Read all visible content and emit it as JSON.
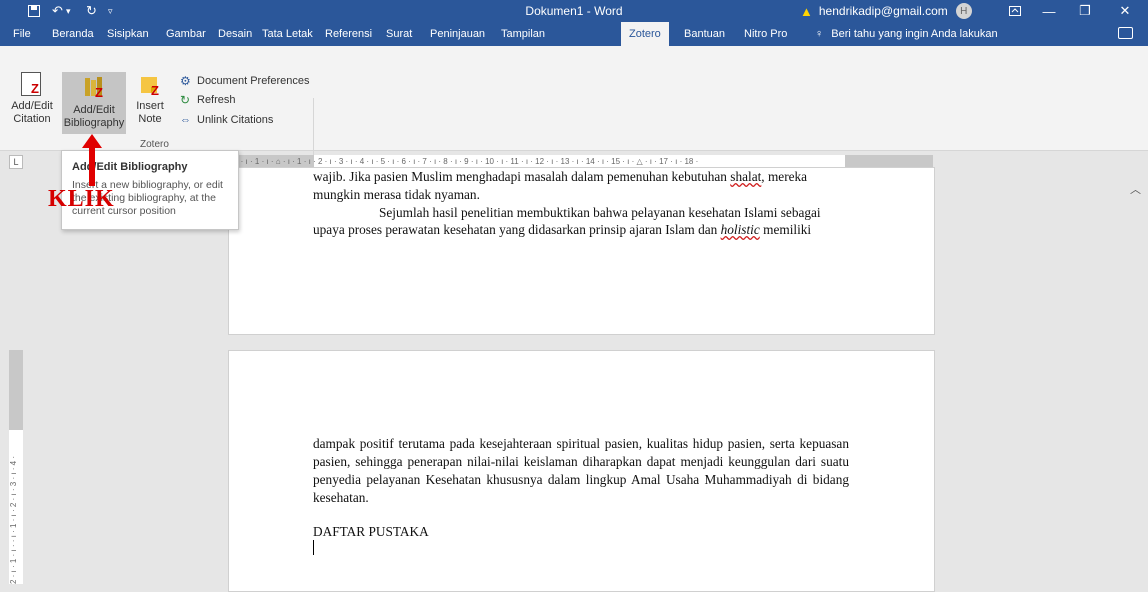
{
  "titlebar": {
    "title": "Dokumen1  -  Word",
    "user_email": "hendrikadip@gmail.com",
    "avatar_initial": "H",
    "accent_color": "#2b579a"
  },
  "menu": {
    "tabs": [
      "File",
      "Beranda",
      "Sisipkan",
      "Gambar",
      "Desain",
      "Tata Letak",
      "Referensi",
      "Surat",
      "Peninjauan",
      "Tampilan",
      "Zotero",
      "Bantuan",
      "Nitro Pro"
    ],
    "active": "Zotero",
    "tell_me": "Beri tahu yang ingin Anda lakukan"
  },
  "ribbon": {
    "add_edit_citation": "Add/Edit Citation",
    "add_edit_citation_l1": "Add/Edit",
    "add_edit_citation_l2": "Citation",
    "add_edit_bibliography_l1": "Add/Edit",
    "add_edit_bibliography_l2": "Bibliography",
    "insert_note_l1": "Insert",
    "insert_note_l2": "Note",
    "document_preferences": "Document Preferences",
    "refresh": "Refresh",
    "unlink_citations": "Unlink Citations",
    "group_label": "Zotero"
  },
  "tooltip": {
    "title": "Add/Edit Bibliography",
    "description": "Insert a new bibliography, or edit the existing bibliography, at the current cursor position"
  },
  "annotation": {
    "label": "KLIK",
    "color": "#d60000"
  },
  "ruler": {
    "horizontal": "2 · ı · 1 · ı · ⌂ · ı · 1 · ı · 2 · ı · 3 · ı · 4 · ı · 5 · ı · 6 · ı · 7 · ı · 8 · ı · 9 · ı · 10 · ı · 11 · ı · 12 · ı · 13 · ı · 14 · ı · 15 · ı · △ · ı · 17 · ı · 18 ·",
    "vertical": "2 · ı · 1 · ı · · ı · 1 · ı · 2 · ı · 3 · ı · 4 ·"
  },
  "document": {
    "page1_line1_a": "wajib. Jika pasien Muslim menghadapi masalah dalam pemenuhan kebutuhan ",
    "page1_line1_b": "shalat",
    "page1_line1_c": ", mereka",
    "page1_line2": "mungkin merasa tidak nyaman.",
    "page1_line3": "Sejumlah hasil penelitian membuktikan bahwa pelayanan kesehatan Islami sebagai",
    "page1_line4_a": "upaya proses perawatan kesehatan yang didasarkan prinsip ajaran Islam dan ",
    "page1_line4_b": "holistic",
    "page1_line4_c": " memiliki",
    "page2_para": "dampak positif terutama pada kesejahteraan spiritual pasien, kualitas hidup pasien, serta kepuasan pasien, sehingga penerapan nilai-nilai keislaman diharapkan dapat menjadi keunggulan dari suatu penyedia pelayanan Kesehatan khususnya dalam lingkup Amal Usaha Muhammadiyah di bidang kesehatan.",
    "heading": "DAFTAR PUSTAKA"
  }
}
